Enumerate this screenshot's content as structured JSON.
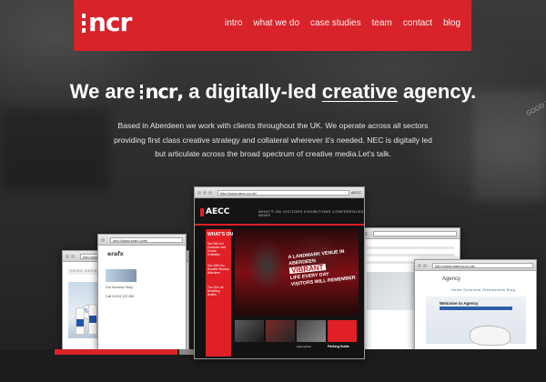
{
  "brand": {
    "logo_text": "ncr",
    "color": "#d8232a"
  },
  "nav": {
    "items": [
      "intro",
      "what we do",
      "case studies",
      "team",
      "contact",
      "blog"
    ]
  },
  "hero": {
    "headline_prefix": "We are",
    "headline_brand": "ncr",
    "headline_sep": ",",
    "headline_mid": "a digitally-led",
    "headline_creative": "creative",
    "headline_suffix": "agency.",
    "intro": "Based in Aberdeen we work with clients throughout the UK. We operate across all sectors providing first class creative strategy and collateral wherever it's needed. NEC is digitally led but articulate across the broad spectrum of creative media.Let's talk."
  },
  "mockups": {
    "aecc": {
      "tab": "AECC",
      "url": "http://www.aecc.co.uk/",
      "logo": "AECC",
      "menu": "WHAT'S ON   VISITORS   EXHIBITIONS   CONFERENCES   NEWS",
      "left_title": "WHAT'S ON",
      "left_items": [
        "Sat 15th Jun Outlander and Ecosia Exhibition",
        "Sun 16th Jun Breathe Warmup Aberdeen",
        "Thu 11th Jul Breathing Bodies"
      ],
      "slogan_1": "A LANDMARK VENUE IN ABERDEEN",
      "slogan_2": "VIBRANT",
      "slogan_3": "LIFE EVERY DAY",
      "slogan_4": "VISITORS WILL REMEMBER",
      "thumb_captions": [
        "",
        "",
        "Approaches",
        "Parking Guide"
      ]
    },
    "erafx": {
      "logo": "erafx",
      "url": "http://www.erafx.com/",
      "captions": [
        "Our Success Story",
        "Call 01224 123 456"
      ]
    },
    "milk": {
      "brand": "Robertsons",
      "url": "http://www.robertsonsdairies.co.uk/",
      "tagline": "ALL THE GOODNESS",
      "nav": "HOME   ABOUT   PRODUCTS   RECIPES   CONTACT"
    },
    "agency": {
      "title": "Agency",
      "url": "http://www.agency.co.uk/",
      "nav": "Home   Solutions   Testimonials   Blog",
      "banner": "Welcome to Agency",
      "chat": "Live chat"
    }
  },
  "side_text": "GOOD NEWS"
}
